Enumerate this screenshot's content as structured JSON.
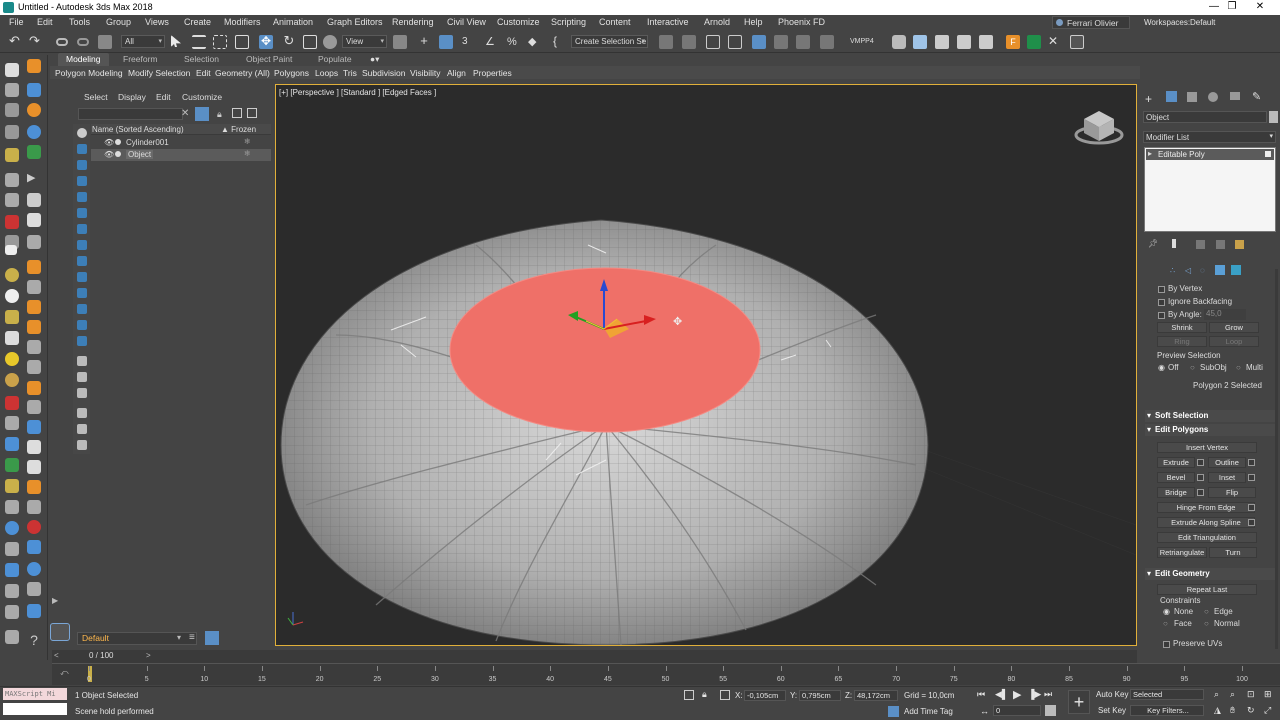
{
  "window": {
    "title": "Untitled - Autodesk 3ds Max 2018",
    "controls": [
      "—",
      "❐",
      "✕"
    ]
  },
  "menu": [
    "File",
    "Edit",
    "Tools",
    "Group",
    "Views",
    "Create",
    "Modifiers",
    "Animation",
    "Graph Editors",
    "Rendering",
    "Civil View",
    "Customize",
    "Scripting",
    "Content",
    "Interactive",
    "Arnold",
    "Help",
    "Phoenix FD"
  ],
  "user": "Ferrari Olivier",
  "workspaces": {
    "label": "Workspaces:",
    "value": "Default"
  },
  "toolbar": {
    "filter": "All",
    "refcoord": "View",
    "selset": "Create Selection Se",
    "vmpp": "VMPP4"
  },
  "ribbon": {
    "tabs": [
      "Modeling",
      "Freeform",
      "Selection",
      "Object Paint",
      "Populate"
    ],
    "items": [
      "Polygon Modeling",
      "Modify Selection",
      "Edit",
      "Geometry (All)",
      "Polygons",
      "Loops",
      "Tris",
      "Subdivision",
      "Visibility",
      "Align",
      "Properties"
    ]
  },
  "explorer": {
    "tabs": [
      "Select",
      "Display",
      "Edit",
      "Customize"
    ],
    "columns": {
      "name": "Name (Sorted Ascending)",
      "frozen": "▲ Frozen"
    },
    "rows": [
      "Cylinder001",
      "Object"
    ],
    "layer": "Default"
  },
  "viewport": {
    "label": "[+] [Perspective ] [Standard ] [Edged Faces ]"
  },
  "cmdpanel": {
    "object_name": "Object",
    "modifier_list": "Modifier List",
    "stack_item": "Editable Poly",
    "by_vertex": "By Vertex",
    "ignore_backfacing": "Ignore Backfacing",
    "by_angle": "By Angle:",
    "by_angle_value": "45,0",
    "shrink": "Shrink",
    "grow": "Grow",
    "ring": "Ring",
    "loop": "Loop",
    "preview_selection": "Preview Selection",
    "preview_opts": [
      "Off",
      "SubObj",
      "Multi"
    ],
    "selection_info": "Polygon 2 Selected",
    "soft_selection": "Soft Selection",
    "edit_polygons": "Edit Polygons",
    "insert_vertex": "Insert Vertex",
    "extrude": "Extrude",
    "outline": "Outline",
    "bevel": "Bevel",
    "inset": "Inset",
    "bridge": "Bridge",
    "flip": "Flip",
    "hinge_from_edge": "Hinge From Edge",
    "extrude_along_spline": "Extrude Along Spline",
    "edit_triangulation": "Edit Triangulation",
    "retriangulate": "Retriangulate",
    "turn": "Turn",
    "edit_geometry": "Edit Geometry",
    "repeat_last": "Repeat Last",
    "constraints": "Constraints",
    "constraint_opts": [
      "None",
      "Edge",
      "Face",
      "Normal"
    ],
    "preserve_uvs": "Preserve UVs"
  },
  "timeline": {
    "frame": "0 / 100",
    "ticks": [
      0,
      5,
      10,
      15,
      20,
      25,
      30,
      35,
      40,
      45,
      50,
      55,
      60,
      65,
      70,
      75,
      80,
      85,
      90,
      95,
      100
    ]
  },
  "status": {
    "maxscript": "MAXScript Mi",
    "selected": "1 Object Selected",
    "prompt": "Scene hold performed",
    "x_label": "X:",
    "x": "-0,105cm",
    "y_label": "Y:",
    "y": "0,795cm",
    "z_label": "Z:",
    "z": "48,172cm",
    "grid": "Grid = 10,0cm",
    "add_time_tag": "Add Time Tag",
    "auto_key": "Auto Key",
    "set_key": "Set Key",
    "selected_dropdown": "Selected",
    "key_filters": "Key Filters...",
    "frame_field": "0"
  },
  "colors": {
    "accent": "#e1b03a",
    "selected_face": "#ef7068",
    "viewport_bg": "#2b2b2b"
  }
}
